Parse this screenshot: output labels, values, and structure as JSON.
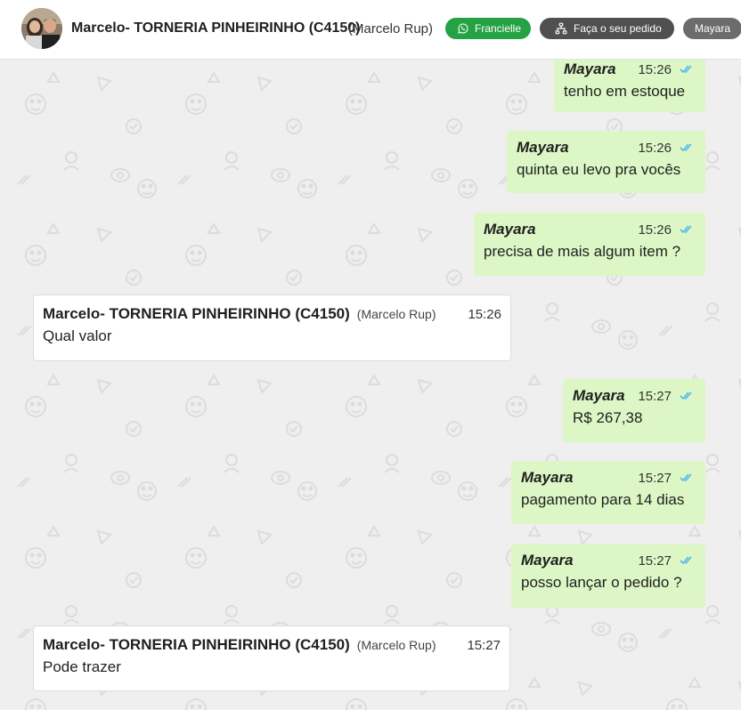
{
  "header": {
    "title": "Marcelo- TORNERIA PINHEIRINHO (C4150)",
    "subtitle": "(Marcelo Rup)",
    "whatsapp_button": "Francielle",
    "order_button": "Faça o seu pedido",
    "agent_button": "Mayara"
  },
  "colors": {
    "outgoing_bubble": "#dcf7c5",
    "incoming_bubble": "#ffffff",
    "whatsapp_green": "#25a244",
    "read_ticks": "#4fb6ec"
  },
  "messages": [
    {
      "direction": "out",
      "sender": "Mayara",
      "time": "15:26",
      "text": "tenho em estoque",
      "status": "read"
    },
    {
      "direction": "out",
      "sender": "Mayara",
      "time": "15:26",
      "text": "quinta eu levo pra vocês",
      "status": "read"
    },
    {
      "direction": "out",
      "sender": "Mayara",
      "time": "15:26",
      "text": "precisa de mais algum item ?",
      "status": "read"
    },
    {
      "direction": "in",
      "sender": "Marcelo- TORNERIA PINHEIRINHO (C4150)",
      "sender_sub": "(Marcelo Rup)",
      "time": "15:26",
      "text": "Qual valor"
    },
    {
      "direction": "out",
      "sender": "Mayara",
      "time": "15:27",
      "text": "R$ 267,38",
      "status": "read"
    },
    {
      "direction": "out",
      "sender": "Mayara",
      "time": "15:27",
      "text": "pagamento para 14 dias",
      "status": "read"
    },
    {
      "direction": "out",
      "sender": "Mayara",
      "time": "15:27",
      "text": "posso lançar o pedido ?",
      "status": "read"
    },
    {
      "direction": "in",
      "sender": "Marcelo- TORNERIA PINHEIRINHO (C4150)",
      "sender_sub": "(Marcelo Rup)",
      "time": "15:27",
      "text": "Pode trazer"
    }
  ]
}
